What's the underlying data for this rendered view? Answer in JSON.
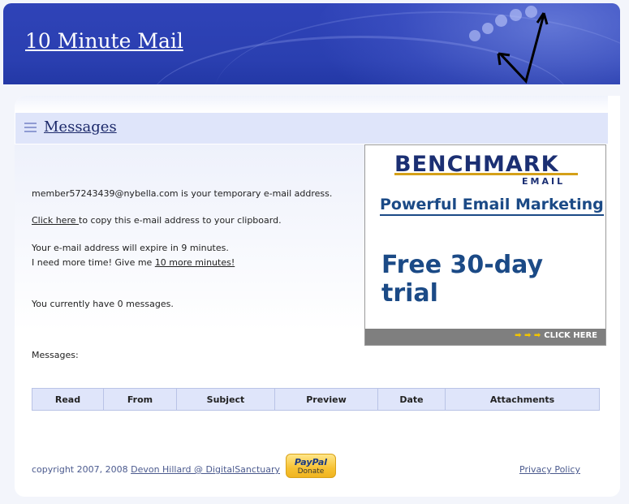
{
  "header": {
    "title": "10 Minute Mail"
  },
  "section": {
    "title": "Messages"
  },
  "main": {
    "address_line": "member57243439@nybella.com is your temporary e-mail address.",
    "copy_link": "Click here ",
    "copy_rest": "to copy this e-mail address to your clipboard.",
    "expire_line": "Your e-mail address will expire in 9 minutes.",
    "more_time_prefix": "I need more time! Give me ",
    "more_time_link": "10 more minutes!",
    "message_count": "You currently have 0 messages.",
    "messages_label": "Messages:"
  },
  "ad": {
    "brand": "BENCHMARK",
    "sub": "EMAIL",
    "headline": "Powerful Email Marketing",
    "offer": "Free 30-day trial",
    "cta": "CLICK HERE",
    "cta_arrows": "➡ ➡ ➡"
  },
  "table": {
    "columns": [
      "Read",
      "From",
      "Subject",
      "Preview",
      "Date",
      "Attachments"
    ]
  },
  "footer": {
    "copyright": "copyright 2007, 2008 ",
    "author_link": "Devon Hillard @ DigitalSanctuary",
    "paypal_logo": "PayPal",
    "paypal_donate": "Donate",
    "privacy": "Privacy Policy"
  },
  "colors": {
    "header_blue": "#2f43b8",
    "section_bar": "#dfe5fa",
    "ad_blue": "#1b4a86",
    "footer_link": "#4b5a8e"
  }
}
